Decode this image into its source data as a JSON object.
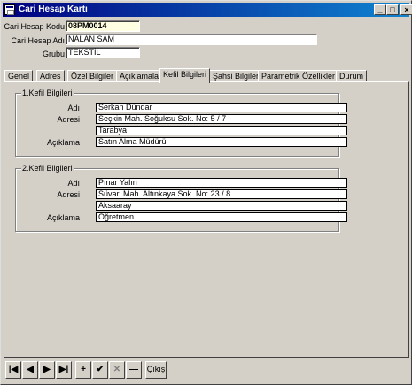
{
  "window": {
    "title": "Cari Hesap Kartı",
    "buttons": {
      "min": "_",
      "max": "□",
      "close": "×"
    }
  },
  "header": {
    "code_label": "Cari Hesap Kodu",
    "code_value": "08PM0014",
    "name_label": "Cari Hesap Adı",
    "name_value": "NALAN SAM",
    "group_label": "Grubu",
    "group_value": "TEKSTİL"
  },
  "tabs": [
    {
      "label": "Genel"
    },
    {
      "label": "Adres"
    },
    {
      "label": "Özel Bilgiler"
    },
    {
      "label": "Açıklamalar"
    },
    {
      "label": "Kefil Bilgileri"
    },
    {
      "label": "Şahsi Bilgiler"
    },
    {
      "label": "Parametrik Özellikler"
    },
    {
      "label": "Durum"
    }
  ],
  "guarantor1": {
    "legend": "1.Kefil Bilgileri",
    "name_label": "Adı",
    "name": "Serkan Dündar",
    "address_label": "Adresi",
    "address1": "Seçkin Mah. Soğuksu Sok.  No: 5 / 7",
    "address2": "Tarabya",
    "note_label": "Açıklama",
    "note": "Satın Alma Müdürü"
  },
  "guarantor2": {
    "legend": "2.Kefil Bilgileri",
    "name_label": "Adı",
    "name": "Pınar Yalın",
    "address_label": "Adresi",
    "address1": "Süvari  Mah.  Altınkaya  Sok. No: 23 / 8",
    "address2": "Aksaaray",
    "note_label": "Açıklama",
    "note": "Öğretmen"
  },
  "navigator": {
    "first": "|◀",
    "prev": "◀",
    "next": "▶",
    "last": "▶|",
    "insert": "+",
    "post": "✔",
    "cancel": "✕",
    "delete": "—",
    "exit": "Çıkış"
  }
}
